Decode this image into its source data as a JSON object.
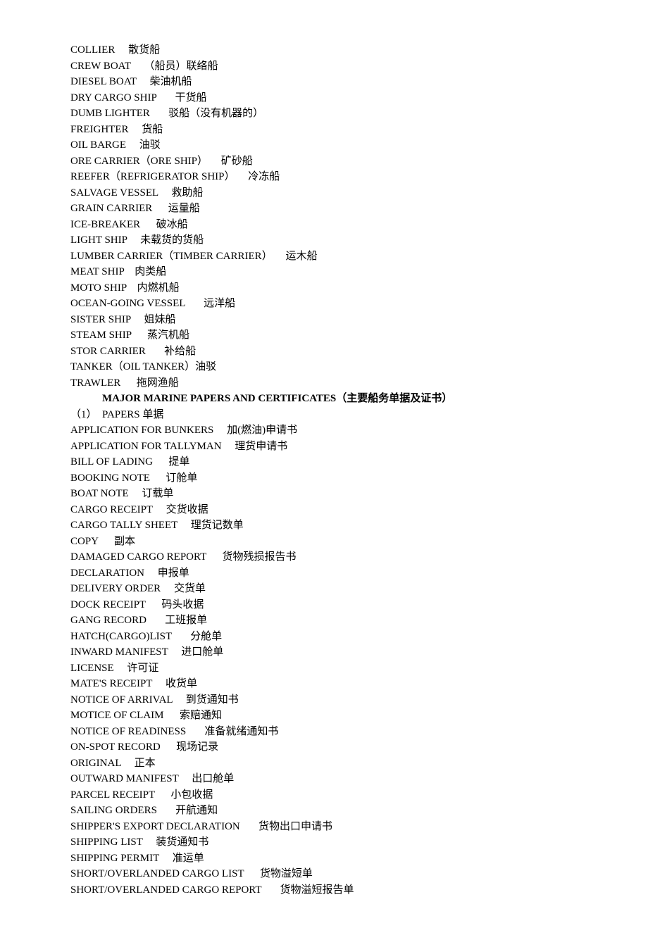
{
  "ship_types": [
    "COLLIER     散货船",
    "CREW BOAT     （船员）联络船",
    "DIESEL BOAT     柴油机船",
    "DRY CARGO SHIP       干货船",
    "DUMB LIGHTER       驳船（没有机器的）",
    "FREIGHTER     货船",
    "OIL BARGE     油驳",
    "ORE CARRIER（ORE SHIP）     矿砂船",
    "REEFER（REFRIGERATOR SHIP）     冷冻船",
    "SALVAGE VESSEL     救助船",
    "GRAIN CARRIER      运量船",
    "ICE-BREAKER      破冰船",
    "LIGHT SHIP     未载货的货船",
    "LUMBER CARRIER（TIMBER CARRIER）     运木船",
    "MEAT SHIP    肉类船",
    "MOTO SHIP    内燃机船",
    "OCEAN-GOING VESSEL       远洋船",
    "SISTER SHIP     姐妹船",
    "STEAM SHIP      蒸汽机船",
    "STOR CARRIER       补给船",
    "TANKER（OIL TANKER）油驳",
    "TRAWLER      拖网渔船"
  ],
  "heading": "            MAJOR MARINE PAPERS AND CERTIFICATES（主要船务单据及证书）",
  "papers_header": "（1）  PAPERS 单据",
  "papers": [
    "APPLICATION FOR BUNKERS     加(燃油)申请书",
    "APPLICATION FOR TALLYMAN     理货申请书",
    "BILL OF LADING      提单",
    "BOOKING NOTE      订舱单",
    "BOAT NOTE     订载单",
    "CARGO RECEIPT     交货收据",
    "CARGO TALLY SHEET     理货记数单",
    "COPY      副本",
    "DAMAGED CARGO REPORT      货物残损报告书",
    "DECLARATION     申报单",
    "DELIVERY ORDER     交货单",
    "DOCK RECEIPT      码头收据",
    "GANG RECORD       工班报单",
    "HATCH(CARGO)LIST       分舱单",
    "INWARD MANIFEST     进口舱单",
    "LICENSE     许可证",
    "MATE'S RECEIPT     收货单",
    "NOTICE OF ARRIVAL     到货通知书",
    "MOTICE OF CLAIM      索赔通知",
    "NOTICE OF READINESS       准备就绪通知书",
    "ON-SPOT RECORD      现场记录",
    "ORIGINAL     正本",
    "OUTWARD MANIFEST     出口舱单",
    "PARCEL RECEIPT      小包收据",
    "SAILING ORDERS       开航通知",
    "SHIPPER'S EXPORT DECLARATION       货物出口申请书",
    "SHIPPING LIST     装货通知书",
    "SHIPPING PERMIT     准运单",
    "SHORT/OVERLANDED CARGO LIST      货物溢短单",
    "SHORT/OVERLANDED CARGO REPORT       货物溢短报告单"
  ]
}
